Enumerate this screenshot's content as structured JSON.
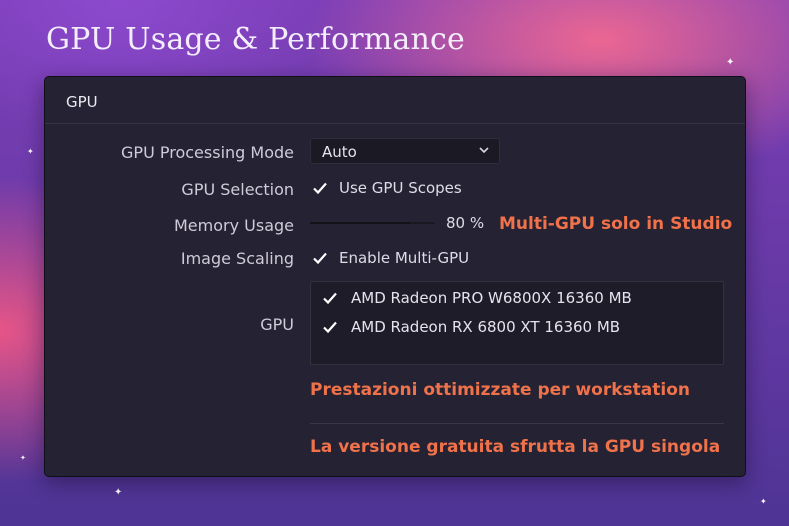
{
  "page": {
    "title": "GPU Usage & Performance"
  },
  "panel": {
    "title": "GPU",
    "processing_mode": {
      "label": "GPU Processing Mode",
      "value": "Auto"
    },
    "gpu_selection": {
      "label": "GPU Selection",
      "option_label": "Use GPU Scopes",
      "checked": true
    },
    "memory_usage": {
      "label": "Memory Usage",
      "value_text": "80 %",
      "value_percent": 80
    },
    "multi_gpu_note": "Multi-GPU solo in Studio",
    "image_scaling": {
      "label": "Image Scaling",
      "option_label": "Enable Multi-GPU",
      "checked": true
    },
    "gpu_list": {
      "label": "GPU",
      "items": [
        {
          "name": "AMD Radeon PRO W6800X  16360 MB",
          "checked": true
        },
        {
          "name": "AMD Radeon RX 6800 XT  16360 MB",
          "checked": true
        }
      ]
    },
    "note_workstation": "Prestazioni ottimizzate per workstation",
    "note_free_version": "La versione gratuita sfrutta la GPU singola"
  },
  "colors": {
    "accent_note": "#f0724a",
    "panel_bg": "#252233",
    "check": "#ffffff"
  },
  "icons": {
    "dropdown": "chevron-down-icon",
    "check": "checkmark-icon",
    "decor": "sparkle-icon"
  }
}
